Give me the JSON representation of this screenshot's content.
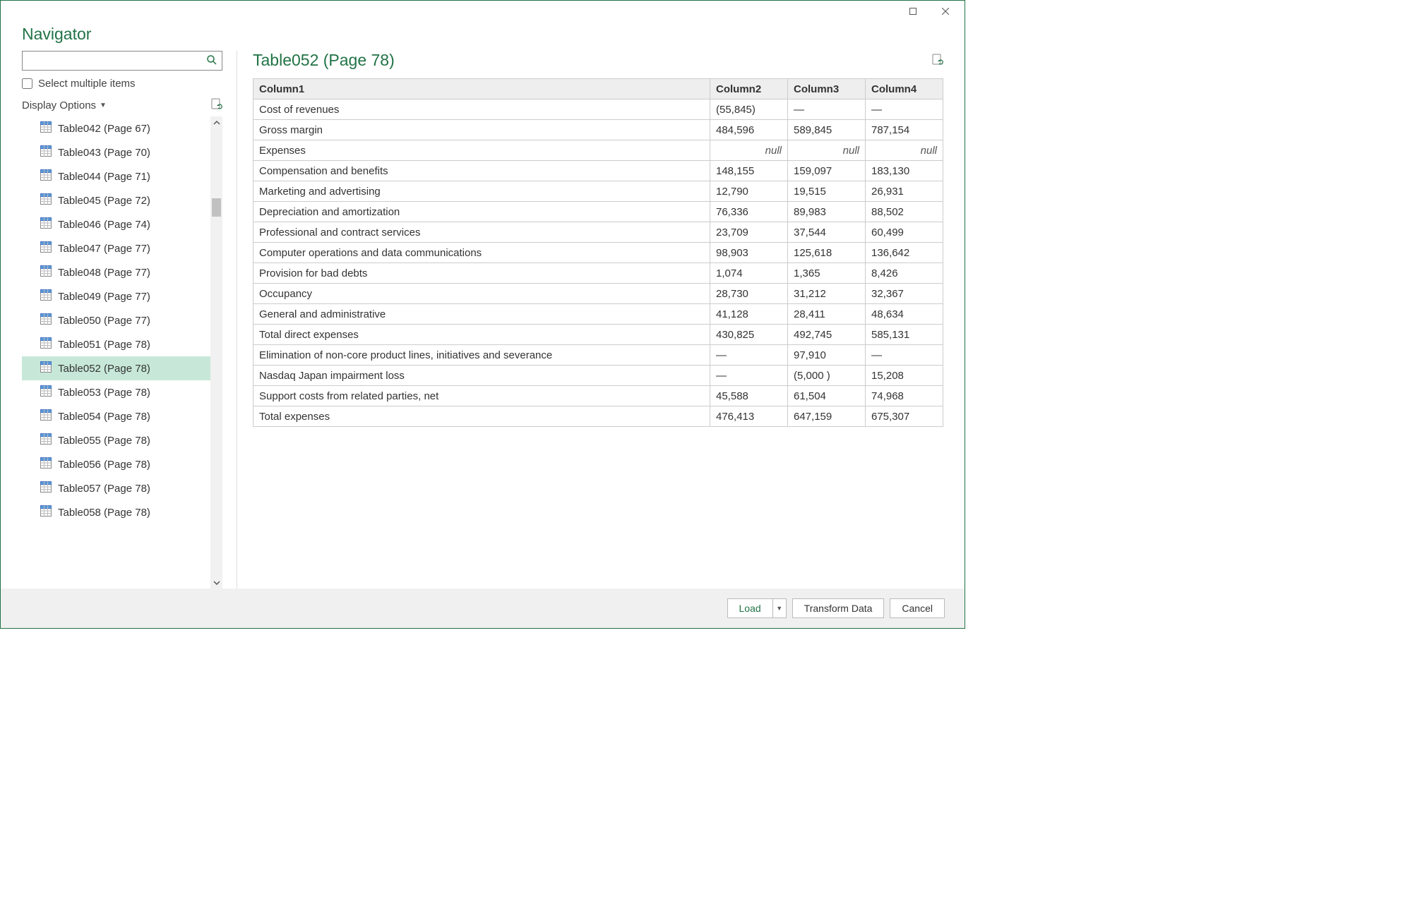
{
  "window": {
    "title": "Navigator"
  },
  "left": {
    "search_placeholder": "",
    "select_multiple_label": "Select multiple items",
    "display_options_label": "Display Options",
    "items": [
      {
        "label": "Table042 (Page 67)"
      },
      {
        "label": "Table043 (Page 70)"
      },
      {
        "label": "Table044 (Page 71)"
      },
      {
        "label": "Table045 (Page 72)"
      },
      {
        "label": "Table046 (Page 74)"
      },
      {
        "label": "Table047 (Page 77)"
      },
      {
        "label": "Table048 (Page 77)"
      },
      {
        "label": "Table049 (Page 77)"
      },
      {
        "label": "Table050 (Page 77)"
      },
      {
        "label": "Table051 (Page 78)"
      },
      {
        "label": "Table052 (Page 78)",
        "selected": true
      },
      {
        "label": "Table053 (Page 78)"
      },
      {
        "label": "Table054 (Page 78)"
      },
      {
        "label": "Table055 (Page 78)"
      },
      {
        "label": "Table056 (Page 78)"
      },
      {
        "label": "Table057 (Page 78)"
      },
      {
        "label": "Table058 (Page 78)"
      }
    ]
  },
  "preview": {
    "title": "Table052 (Page 78)",
    "columns": [
      "Column1",
      "Column2",
      "Column3",
      "Column4"
    ],
    "rows": [
      [
        "Cost of revenues",
        "(55,845)",
        "—",
        "—"
      ],
      [
        "Gross margin",
        "484,596",
        "589,845",
        "787,154"
      ],
      [
        "Expenses",
        null,
        null,
        null
      ],
      [
        "Compensation and benefits",
        "148,155",
        "159,097",
        "183,130"
      ],
      [
        "Marketing and advertising",
        "12,790",
        "19,515",
        "26,931"
      ],
      [
        "Depreciation and amortization",
        "76,336",
        "89,983",
        "88,502"
      ],
      [
        "Professional and contract services",
        "23,709",
        "37,544",
        "60,499"
      ],
      [
        "Computer operations and data communications",
        "98,903",
        "125,618",
        "136,642"
      ],
      [
        "Provision for bad debts",
        "1,074",
        "1,365",
        "8,426"
      ],
      [
        "Occupancy",
        "28,730",
        "31,212",
        "32,367"
      ],
      [
        "General and administrative",
        "41,128",
        "28,411",
        "48,634"
      ],
      [
        "Total direct expenses",
        "430,825",
        "492,745",
        "585,131"
      ],
      [
        "Elimination of non-core product lines, initiatives and severance",
        "—",
        "97,910",
        "—"
      ],
      [
        "Nasdaq Japan impairment loss",
        "—",
        "(5,000 )",
        "15,208"
      ],
      [
        "Support costs from related parties, net",
        "45,588",
        "61,504",
        "74,968"
      ],
      [
        "Total expenses",
        "476,413",
        "647,159",
        "675,307"
      ]
    ]
  },
  "footer": {
    "load_label": "Load",
    "transform_label": "Transform Data",
    "cancel_label": "Cancel"
  }
}
